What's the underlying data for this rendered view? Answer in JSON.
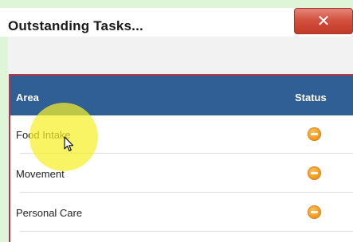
{
  "dialog": {
    "title": "Outstanding Tasks...",
    "close_label": "✕"
  },
  "table": {
    "columns": [
      "Area",
      "Status"
    ],
    "rows": [
      {
        "area": "Food Intake",
        "status_icon": "pending-minus-icon"
      },
      {
        "area": "Movement",
        "status_icon": "pending-minus-icon"
      },
      {
        "area": "Personal Care",
        "status_icon": "pending-minus-icon"
      }
    ],
    "header_color": "#2f5f95",
    "status_color": "#f39a1a"
  },
  "colors": {
    "close_button": "#d35240",
    "panel_border": "#b73742",
    "click_highlight": "#f6f028"
  }
}
